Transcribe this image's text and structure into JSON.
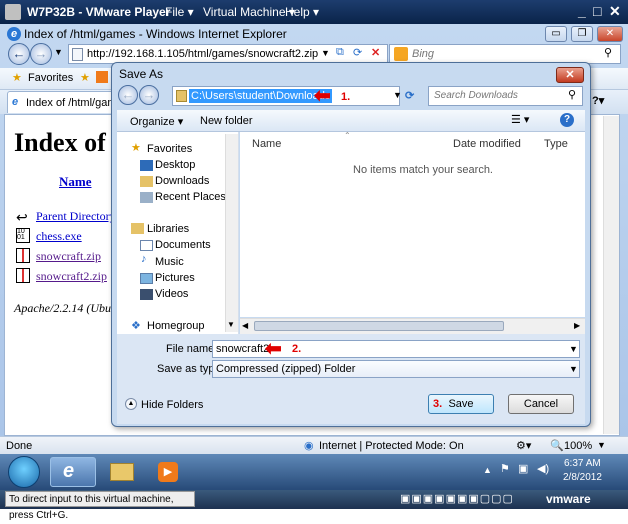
{
  "vm": {
    "title": "W7P32B - VMware Player",
    "menus": [
      "File ▾",
      "Virtual Machine ▾",
      "Help ▾"
    ],
    "status_msg": "To direct input to this virtual machine, press Ctrl+G.",
    "brand": "vmware"
  },
  "ie": {
    "window_title": "Index of /html/games - Windows Internet Explorer",
    "address": "http://192.168.1.105/html/games/snowcraft2.zip",
    "search_placeholder": "Bing",
    "favorites_label": "Favorites",
    "tab_label": "Index of /html/games",
    "status_text": "Done",
    "zone_text": "Internet | Protected Mode: On",
    "zoom": "100%"
  },
  "page": {
    "heading": "Index of /",
    "column_name": "Name",
    "files": [
      {
        "name": "Parent Directory",
        "icon": "back-arrow-icon"
      },
      {
        "name": "chess.exe",
        "icon": "binary-icon"
      },
      {
        "name": "snowcraft.zip",
        "icon": "zip-icon"
      },
      {
        "name": "snowcraft2.zip",
        "icon": "zip-icon"
      }
    ],
    "footer": "Apache/2.2.14 (Ubu"
  },
  "dialog": {
    "title": "Save As",
    "path": "C:\\Users\\student\\Downloads",
    "search_placeholder": "Search Downloads",
    "organize_label": "Organize ▾",
    "new_folder_label": "New folder",
    "nav": {
      "favorites": "Favorites",
      "favorites_items": [
        "Desktop",
        "Downloads",
        "Recent Places"
      ],
      "libraries": "Libraries",
      "libraries_items": [
        "Documents",
        "Music",
        "Pictures",
        "Videos"
      ],
      "homegroup": "Homegroup"
    },
    "columns": [
      "Name",
      "Date modified",
      "Type"
    ],
    "empty_message": "No items match your search.",
    "file_name_label": "File name:",
    "file_name_value": "snowcraft2",
    "save_type_label": "Save as type:",
    "save_type_value": "Compressed (zipped) Folder",
    "hide_folders_label": "Hide Folders",
    "save_label": "Save",
    "cancel_label": "Cancel",
    "annotations": {
      "step1": "1.",
      "step2": "2.",
      "step3": "3."
    }
  },
  "taskbar": {
    "time": "6:37 AM",
    "date": "2/8/2012"
  },
  "colors": {
    "annotation": "#e00000",
    "selection": "#3399ff"
  }
}
